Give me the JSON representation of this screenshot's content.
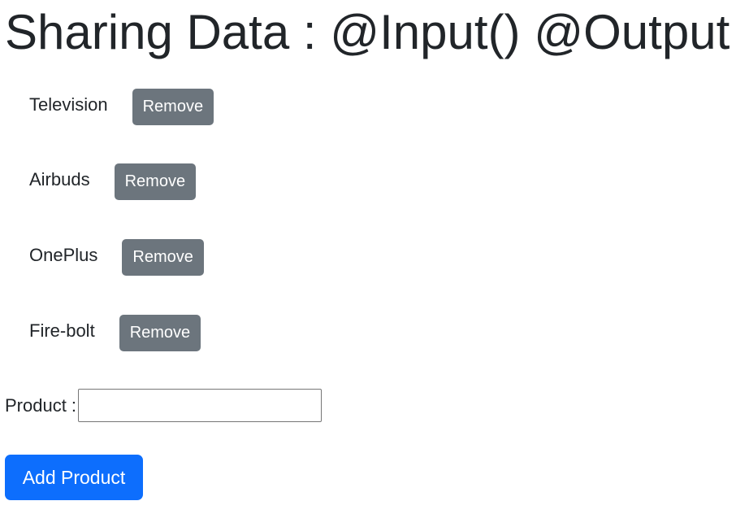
{
  "header": {
    "title": "Sharing Data : @Input() @Output"
  },
  "products": {
    "items": [
      {
        "name": "Television",
        "remove_label": "Remove"
      },
      {
        "name": "Airbuds",
        "remove_label": "Remove"
      },
      {
        "name": "OnePlus",
        "remove_label": "Remove"
      },
      {
        "name": "Fire-bolt",
        "remove_label": "Remove"
      }
    ]
  },
  "form": {
    "product_label": "Product :",
    "product_value": "",
    "product_placeholder": "",
    "add_label": "Add Product"
  },
  "colors": {
    "remove_button": "#6c757d",
    "add_button": "#0d6efd",
    "text": "#212529"
  }
}
